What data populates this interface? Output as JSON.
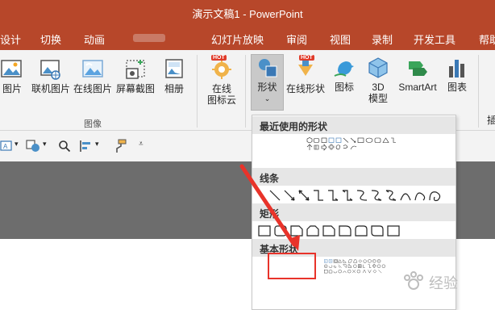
{
  "window": {
    "title": "演示文稿1 - PowerPoint"
  },
  "tabs": [
    {
      "label": "设计"
    },
    {
      "label": "切换"
    },
    {
      "label": "动画"
    },
    {
      "label": "幻灯片放映"
    },
    {
      "label": "审阅"
    },
    {
      "label": "视图"
    },
    {
      "label": "录制"
    },
    {
      "label": "开发工具"
    },
    {
      "label": "帮助"
    }
  ],
  "ribbon": {
    "images_group": {
      "label": "图像",
      "buttons": [
        {
          "label": "图片",
          "icon": "picture-icon"
        },
        {
          "label": "联机图片",
          "icon": "online-picture-icon"
        },
        {
          "label": "在线图片",
          "icon": "web-picture-icon"
        },
        {
          "label": "屏幕截图",
          "icon": "screenshot-icon"
        },
        {
          "label": "相册",
          "icon": "photo-album-icon"
        }
      ]
    },
    "online_icons": {
      "line1": "在线",
      "line2": "图标云",
      "badge": "HOT"
    },
    "shapes": {
      "label": "形状",
      "icon": "shapes-icon"
    },
    "online_shapes": {
      "label": "在线形状",
      "badge": "HOT"
    },
    "icons": {
      "label": "图标"
    },
    "model3d": {
      "line1": "3D",
      "line2": "模型"
    },
    "smartart": {
      "label": "SmartArt"
    },
    "chart": {
      "label": "图表"
    },
    "partial": "插"
  },
  "shapes_dropdown": {
    "sections": [
      {
        "title": "最近使用的形状"
      },
      {
        "title": "线条"
      },
      {
        "title": "矩形"
      },
      {
        "title": "基本形状"
      }
    ],
    "selected_shape": "oval"
  },
  "watermark": {
    "text": "经验"
  },
  "colors": {
    "accent": "#b7472a",
    "highlight": "#e8332a"
  }
}
